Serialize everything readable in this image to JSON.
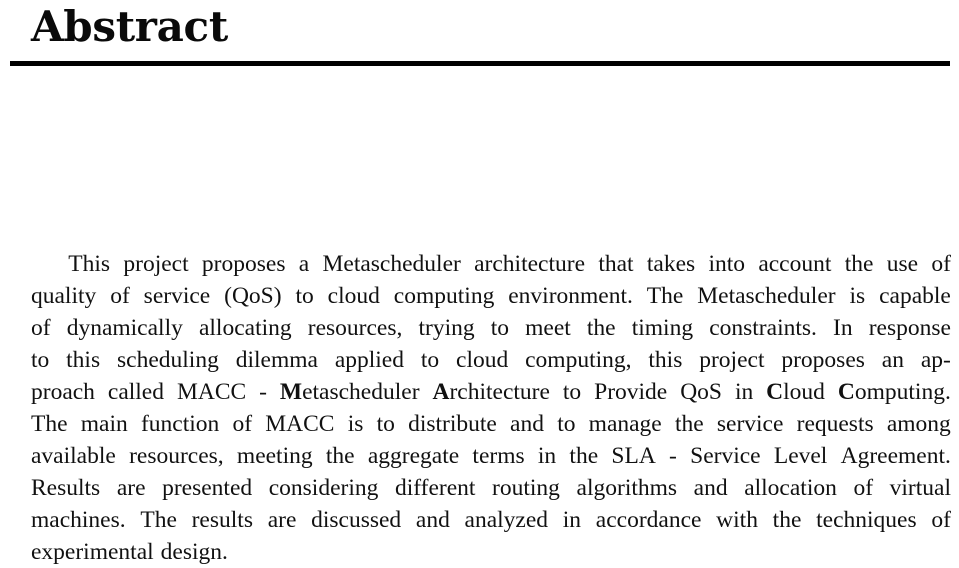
{
  "document": {
    "heading": "Abstract",
    "divider": {
      "color": "#000000"
    },
    "abstract": {
      "full_text": "This project proposes a Metascheduler architecture that takes into account the use of quality of service (QoS) to cloud computing environment. The Metascheduler is capable of dynamically allocating resources, trying to meet the timing constraints. In response to this scheduling dilemma applied to cloud computing, this project proposes an approach called MACC - Metascheduler Architecture to Provide QoS in Cloud Computing. The main function of MACC is to distribute and to manage the service requests among available resources, meeting the aggregate terms in the SLA - Service Level Agreement. Results are presented considering different routing algorithms and allocation of virtual machines. The results are discussed and analyzed in accordance with the techniques of experimental design.",
      "lines": [
        {
          "id": "line-1",
          "justified": true,
          "indent": true,
          "words": [
            "This",
            "project",
            "proposes",
            "a",
            "Metascheduler",
            "architecture",
            "that",
            "takes",
            "into",
            "account",
            "the",
            "use",
            "of"
          ]
        },
        {
          "id": "line-2",
          "justified": true,
          "indent": false,
          "words": [
            "quality",
            "of",
            "service",
            "(QoS)",
            "to",
            "cloud",
            "computing",
            "environment.",
            "The",
            "Metascheduler",
            "is",
            "capable"
          ]
        },
        {
          "id": "line-3",
          "justified": true,
          "indent": false,
          "words": [
            "of",
            "dynamically",
            "allocating",
            "resources,",
            "trying",
            "to",
            "meet",
            "the",
            "timing",
            "constraints.",
            "In",
            "response"
          ]
        },
        {
          "id": "line-4",
          "justified": true,
          "indent": false,
          "words": [
            "to",
            "this",
            "scheduling",
            "dilemma",
            "applied",
            "to",
            "cloud",
            "computing,",
            "this",
            "project",
            "proposes",
            "an",
            "ap-"
          ]
        },
        {
          "id": "line-5",
          "justified": true,
          "indent": false,
          "segments": [
            {
              "text": "proach",
              "bold": false
            },
            {
              "text": "called",
              "bold": false
            },
            {
              "text": "MACC",
              "bold": false
            },
            {
              "text": "-",
              "bold": false
            },
            {
              "text": "Metascheduler",
              "bold_first_letter": true
            },
            {
              "text": "Architecture",
              "bold_first_letter": true
            },
            {
              "text": "to",
              "bold": false
            },
            {
              "text": "Provide",
              "bold": false
            },
            {
              "text": "QoS",
              "bold": false
            },
            {
              "text": "in",
              "bold": false
            },
            {
              "text": "Cloud",
              "bold_first_letter": true
            },
            {
              "text": "Computing.",
              "bold_first_letter": true
            }
          ]
        },
        {
          "id": "line-6",
          "justified": true,
          "indent": false,
          "words": [
            "The",
            "main",
            "function",
            "of",
            "MACC",
            "is",
            "to",
            "distribute",
            "and",
            "to",
            "manage",
            "the",
            "service",
            "requests",
            "among"
          ]
        },
        {
          "id": "line-7",
          "justified": true,
          "indent": false,
          "words": [
            "available",
            "resources,",
            "meeting",
            "the",
            "aggregate",
            "terms",
            "in",
            "the",
            "SLA",
            "-",
            "Service",
            "Level",
            "Agreement."
          ]
        },
        {
          "id": "line-8",
          "justified": true,
          "indent": false,
          "words": [
            "Results",
            "are",
            "presented",
            "considering",
            "different",
            "routing",
            "algorithms",
            "and",
            "allocation",
            "of",
            "virtual"
          ]
        },
        {
          "id": "line-9",
          "justified": true,
          "indent": false,
          "words": [
            "machines.",
            "The",
            "results",
            "are",
            "discussed",
            "and",
            "analyzed",
            "in",
            "accordance",
            "with",
            "the",
            "techniques",
            "of"
          ]
        },
        {
          "id": "line-10",
          "justified": false,
          "indent": false,
          "words": [
            "experimental",
            "design."
          ]
        }
      ]
    }
  }
}
